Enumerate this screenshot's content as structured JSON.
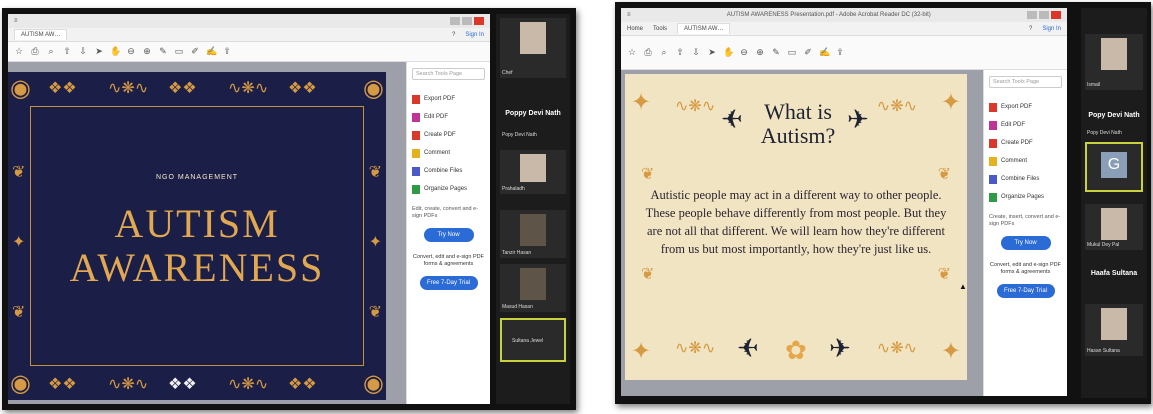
{
  "left_screenshot": {
    "window_title": "",
    "tab_label": "AUTISM AW…",
    "sign_in": "Sign In",
    "slide": {
      "small_caption": "NGO MANAGEMENT",
      "title_line1": "AUTISM",
      "title_line2": "AWARENESS"
    },
    "side_panel": {
      "search_placeholder": "Search Tools Page",
      "tools": [
        {
          "label": "Export PDF",
          "color": "#d9382b"
        },
        {
          "label": "Edit PDF",
          "color": "#c2339a"
        },
        {
          "label": "Create PDF",
          "color": "#d9382b"
        },
        {
          "label": "Comment",
          "color": "#e4b21c"
        },
        {
          "label": "Combine Files",
          "color": "#4b58c8"
        },
        {
          "label": "Organize Pages",
          "color": "#2e9b47"
        }
      ],
      "note": "Edit, create, convert and e-sign PDFs",
      "try_button": "Try Now",
      "promo_text": "Convert, edit and e-sign PDF forms & agreements",
      "free_trial_button": "Free 7-Day Trial"
    },
    "participants": [
      {
        "name": "Chef",
        "dark": false
      },
      {
        "name": "Popy Devi Nath",
        "dark": false
      },
      {
        "name": "Prahaladh",
        "dark": false
      },
      {
        "name": "Tanzir Hasan",
        "dark": true
      },
      {
        "name": "Masud Hasan",
        "dark": true
      },
      {
        "name": "Sultana Jewel",
        "dark": false
      }
    ],
    "speaker_label": "Poppy Devi Nath"
  },
  "right_screenshot": {
    "window_title": "AUTISM AWARENESS Presentation.pdf - Adobe Acrobat Reader DC (32-bit)",
    "tab_label": "AUTISM AW…",
    "menu": [
      "Home",
      "Tools"
    ],
    "sign_in": "Sign In",
    "slide": {
      "title_line1": "What is",
      "title_line2": "Autism?",
      "body": "Autistic people may act in a different way to other people. These people behave differently from most people. But they are not all that different. We will learn how they're different from us but most importantly, how they're just like us."
    },
    "side_panel": {
      "search_placeholder": "Search Tools Page",
      "tools": [
        {
          "label": "Export PDF",
          "color": "#d9382b"
        },
        {
          "label": "Edit PDF",
          "color": "#c2339a"
        },
        {
          "label": "Create PDF",
          "color": "#d9382b"
        },
        {
          "label": "Comment",
          "color": "#e4b21c"
        },
        {
          "label": "Combine Files",
          "color": "#4b58c8"
        },
        {
          "label": "Organize Pages",
          "color": "#2e9b47"
        }
      ],
      "note": "Create, insert, convert and e-sign PDFs",
      "try_button": "Try Now",
      "promo_text": "Convert, edit and e-sign PDF forms & agreements",
      "free_trial_button": "Free 7-Day Trial"
    },
    "participants": [
      {
        "name": "Ismail",
        "dark": false
      },
      {
        "name": "Popy Devi Nath",
        "dark": false
      },
      {
        "name": "Mukul Dey Pal",
        "dark": false
      },
      {
        "name": "Hasan Sultana",
        "dark": false
      }
    ],
    "speaker_label": "Popy Devi Nath",
    "second_label": "Haafa Sultana",
    "active_avatar_letter": "G"
  }
}
